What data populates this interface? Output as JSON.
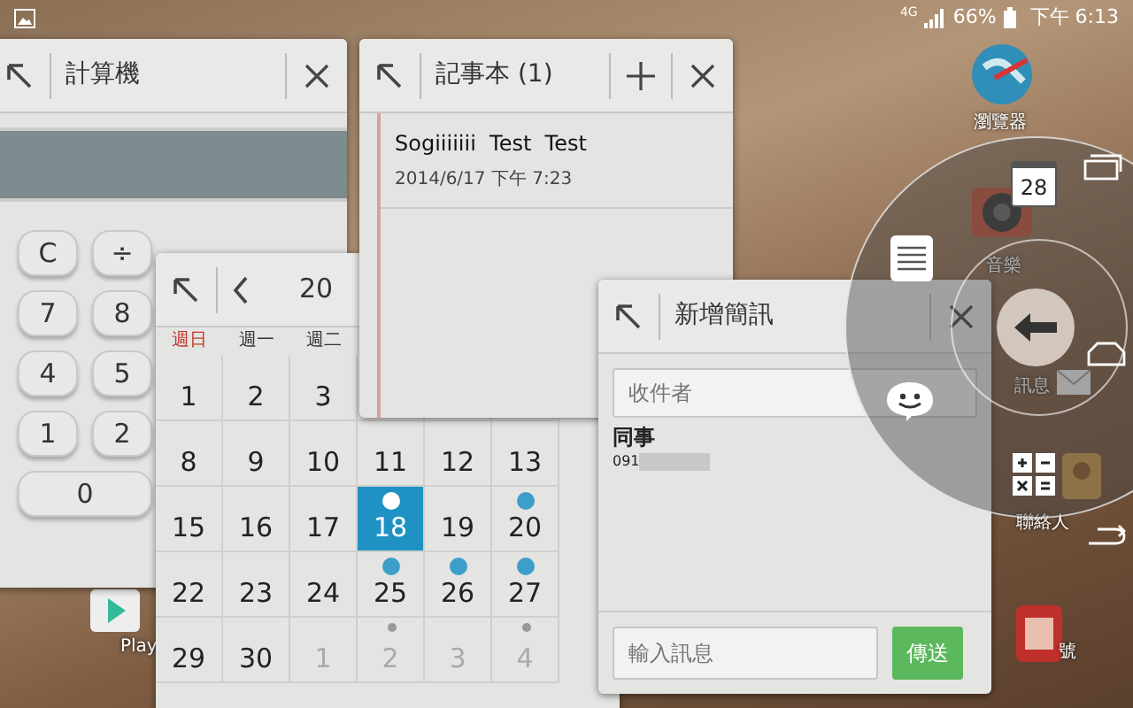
{
  "status_bar": {
    "network": "4G",
    "battery": "66%",
    "time": "下午 6:13"
  },
  "home_apps": [
    {
      "label": "瀏覽器",
      "kind": "browser"
    },
    {
      "label": "音樂",
      "kind": "music"
    },
    {
      "label": "訊息",
      "kind": "messages"
    },
    {
      "label": "聯絡人",
      "kind": "contacts"
    },
    {
      "label": "號",
      "kind": "phone"
    },
    {
      "label": "Play",
      "kind": "play"
    }
  ],
  "calculator": {
    "title": "計算機",
    "keys": [
      "C",
      "÷",
      "7",
      "8",
      "4",
      "5",
      "1",
      "2",
      "0"
    ]
  },
  "calendar": {
    "title": "20",
    "weekdays": [
      {
        "label": "週日",
        "weekend": true
      },
      {
        "label": "週一",
        "weekend": false
      },
      {
        "label": "週二",
        "weekend": false
      }
    ],
    "weeks": [
      [
        {
          "day": "1",
          "selected": false,
          "event": false,
          "other_month": false
        },
        {
          "day": "2",
          "selected": false,
          "event": false,
          "other_month": false
        },
        {
          "day": "3",
          "selected": false,
          "event": false,
          "other_month": false
        }
      ],
      [
        {
          "day": "8",
          "selected": false,
          "event": false,
          "other_month": false
        },
        {
          "day": "9",
          "selected": false,
          "event": false,
          "other_month": false
        },
        {
          "day": "10",
          "selected": false,
          "event": false,
          "other_month": false
        },
        {
          "day": "11",
          "selected": false,
          "event": false,
          "other_month": false
        },
        {
          "day": "12",
          "selected": false,
          "event": false,
          "other_month": false
        },
        {
          "day": "13",
          "selected": false,
          "event": false,
          "other_month": false
        }
      ],
      [
        {
          "day": "15",
          "selected": false,
          "event": false,
          "other_month": false
        },
        {
          "day": "16",
          "selected": false,
          "event": false,
          "other_month": false
        },
        {
          "day": "17",
          "selected": false,
          "event": false,
          "other_month": false
        },
        {
          "day": "18",
          "selected": true,
          "event": true,
          "other_month": false
        },
        {
          "day": "19",
          "selected": false,
          "event": false,
          "other_month": false
        },
        {
          "day": "20",
          "selected": false,
          "event": true,
          "other_month": false
        }
      ],
      [
        {
          "day": "22",
          "selected": false,
          "event": false,
          "other_month": false
        },
        {
          "day": "23",
          "selected": false,
          "event": false,
          "other_month": false
        },
        {
          "day": "24",
          "selected": false,
          "event": false,
          "other_month": false
        },
        {
          "day": "25",
          "selected": false,
          "event": true,
          "other_month": false
        },
        {
          "day": "26",
          "selected": false,
          "event": true,
          "other_month": false
        },
        {
          "day": "27",
          "selected": false,
          "event": true,
          "other_month": false
        }
      ],
      [
        {
          "day": "29",
          "selected": false,
          "event": false,
          "other_month": false
        },
        {
          "day": "30",
          "selected": false,
          "event": false,
          "other_month": false
        },
        {
          "day": "1",
          "selected": false,
          "event": false,
          "other_month": true
        },
        {
          "day": "2",
          "selected": false,
          "event": true,
          "other_month": true
        },
        {
          "day": "3",
          "selected": false,
          "event": false,
          "other_month": true
        },
        {
          "day": "4",
          "selected": false,
          "event": true,
          "other_month": true
        }
      ]
    ]
  },
  "notepad": {
    "title": "記事本 (1)",
    "notes": [
      {
        "title": "Sogiiiiiii  Test  Test",
        "date": "2014/6/17 下午 7:23"
      }
    ]
  },
  "message": {
    "title": "新增簡訊",
    "recipient_placeholder": "收件者",
    "contact": {
      "name": "同事",
      "number": "091"
    },
    "message_placeholder": "輸入訊息",
    "send": "傳送"
  },
  "quick_circle": {
    "calendar_day": "28"
  }
}
